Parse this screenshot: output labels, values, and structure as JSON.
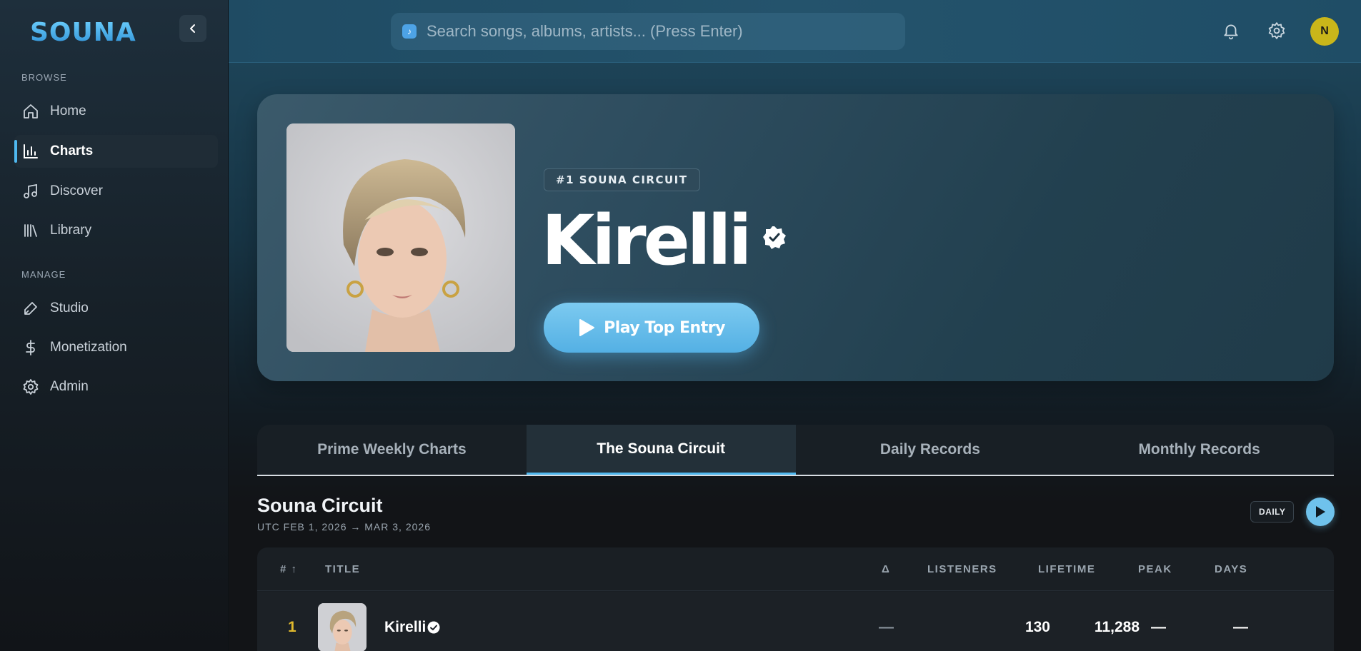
{
  "app": {
    "logo": "SOUNA"
  },
  "sidebar": {
    "browse_label": "BROWSE",
    "manage_label": "MANAGE",
    "browse_items": [
      {
        "label": "Home",
        "icon": "home-icon"
      },
      {
        "label": "Charts",
        "icon": "bar-chart-icon",
        "active": true
      },
      {
        "label": "Discover",
        "icon": "music-note-icon"
      },
      {
        "label": "Library",
        "icon": "library-icon"
      }
    ],
    "manage_items": [
      {
        "label": "Studio",
        "icon": "pen-icon"
      },
      {
        "label": "Monetization",
        "icon": "dollar-icon"
      },
      {
        "label": "Admin",
        "icon": "gear-icon"
      }
    ]
  },
  "header": {
    "search_placeholder": "Search songs, albums, artists... (Press Enter)",
    "avatar_initial": "N"
  },
  "hero": {
    "badge": "#1 SOUNA CIRCUIT",
    "artist": "Kirelli",
    "play_label": "Play Top Entry"
  },
  "tabs": [
    {
      "label": "Prime Weekly Charts"
    },
    {
      "label": "The Souna Circuit",
      "active": true
    },
    {
      "label": "Daily Records"
    },
    {
      "label": "Monthly Records"
    }
  ],
  "section": {
    "title": "Souna Circuit",
    "range": "UTC FEB 1, 2026 → MAR 3, 2026",
    "period_badge": "DAILY"
  },
  "table": {
    "headers": {
      "rank": "# ↑",
      "title": "TITLE",
      "delta": "Δ",
      "listeners": "LISTENERS",
      "lifetime": "LIFETIME",
      "peak": "PEAK",
      "days": "DAYS"
    },
    "rows": [
      {
        "rank": "1",
        "title": "Kirelli",
        "delta": "—",
        "listeners": "130",
        "lifetime": "11,288",
        "peak": "—",
        "days": "—"
      }
    ]
  },
  "colors": {
    "accent": "#4fb8ef",
    "rank_gold": "#e0b92d",
    "avatar": "#c9b61a"
  }
}
